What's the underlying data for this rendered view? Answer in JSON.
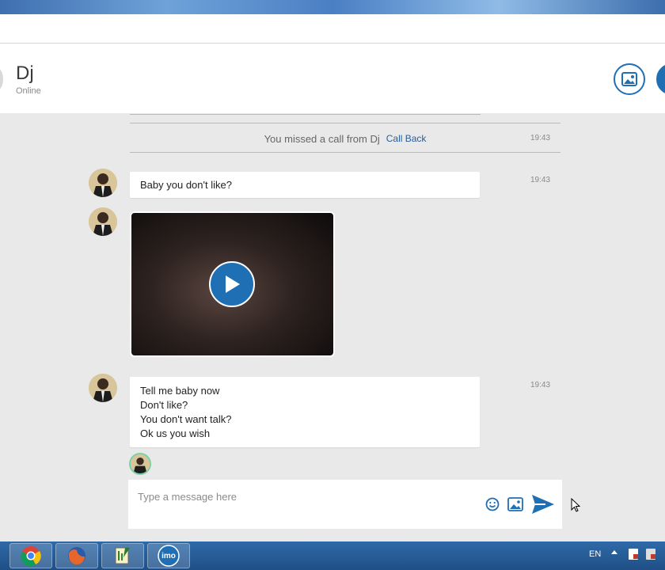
{
  "header": {
    "contact_name": "Dj",
    "contact_status": "Online",
    "photo_button_icon": "image-icon",
    "accent_color": "#1f6fb5"
  },
  "missed_call": {
    "text": "You missed a call from Dj",
    "action_label": "Call Back",
    "time": "19:43"
  },
  "messages": [
    {
      "lines": [
        "Baby you don't like?"
      ],
      "time": "19:43"
    },
    {
      "type": "video"
    },
    {
      "lines": [
        "Tell me baby now",
        "Don't like?",
        "You don't want talk?",
        "Ok us you wish"
      ],
      "time": "19:43"
    }
  ],
  "composer": {
    "placeholder": "Type a message here",
    "emoji_icon": "smiley-icon",
    "image_icon": "image-icon",
    "send_icon": "send-icon"
  },
  "taskbar": {
    "apps": [
      "chrome-icon",
      "firefox-icon",
      "notepad-icon",
      "imo-icon"
    ],
    "imo_label": "imo",
    "language": "EN"
  }
}
